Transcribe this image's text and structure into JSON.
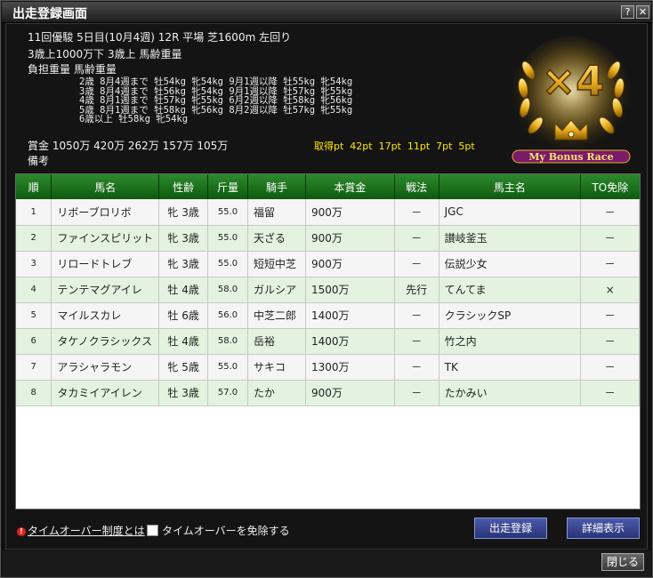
{
  "window": {
    "title": "出走登録画面",
    "help_label": "?",
    "close_label": "✕"
  },
  "race": {
    "line1": "11回優駿 5日目(10月4週) 12R  平場  芝1600m  左回り",
    "line2": "3歳上1000万下  3歳上  馬齢重量",
    "line3": "負担重量  馬齢重量",
    "conditions": [
      "2歳 8月4週まで 牡54kg 牝54kg 9月1週以降 牡55kg 牝54kg",
      "3歳 8月4週まで 牡56kg 牝54kg 9月1週以降 牡57kg 牝55kg",
      "4歳 8月1週まで 牡57kg 牝55kg 6月2週以降 牡58kg 牝56kg",
      "5歳 8月1週まで 牡58kg 牝56kg 8月2週以降 牡57kg 牝55kg",
      "6歳以上 牡58kg 牝54kg"
    ],
    "prize": "賞金  1050万  420万  262万  157万  105万",
    "points": "取得pt  42pt  17pt  11pt  7pt  5pt",
    "remarks": "備考"
  },
  "badge": {
    "multiplier": "×4",
    "caption": "My Bonus Race",
    "gold": "#e8b020",
    "purple": "#7a1a6a"
  },
  "table": {
    "headers": [
      "順",
      "馬名",
      "性齢",
      "斤量",
      "騎手",
      "本賞金",
      "戦法",
      "馬主名",
      "TO免除"
    ],
    "rows": [
      [
        "1",
        "リボーブロリボ",
        "牝 3歳",
        "55.0",
        "福留",
        "900万",
        "－",
        "JGC",
        "－"
      ],
      [
        "2",
        "ファインスピリット",
        "牝 3歳",
        "55.0",
        "天ざる",
        "900万",
        "－",
        "讃岐釜玉",
        "－"
      ],
      [
        "3",
        "リロードトレブ",
        "牝 3歳",
        "55.0",
        "短短中芝",
        "900万",
        "－",
        "伝説少女",
        "－"
      ],
      [
        "4",
        "テンテマグアイレ",
        "牡 4歳",
        "58.0",
        "ガルシア",
        "1500万",
        "先行",
        "てんてま",
        "×"
      ],
      [
        "5",
        "マイルスカレ",
        "牡 6歳",
        "56.0",
        "中芝二郎",
        "1400万",
        "－",
        "クラシックSP",
        "－"
      ],
      [
        "6",
        "タケノクラシックス",
        "牡 4歳",
        "58.0",
        "岳裕",
        "1400万",
        "－",
        "竹之内",
        "－"
      ],
      [
        "7",
        "アラシャラモン",
        "牝 5歳",
        "55.0",
        "サキコ",
        "1300万",
        "－",
        "TK",
        "－"
      ],
      [
        "8",
        "タカミイアイレン",
        "牡 3歳",
        "57.0",
        "たか",
        "900万",
        "－",
        "たかみい",
        "－"
      ]
    ]
  },
  "footer": {
    "to_link": "タイムオーバー制度とは",
    "to_checkbox": "タイムオーバーを免除する",
    "entry_button": "出走登録",
    "detail_button": "詳細表示",
    "close_button": "閉じる"
  }
}
